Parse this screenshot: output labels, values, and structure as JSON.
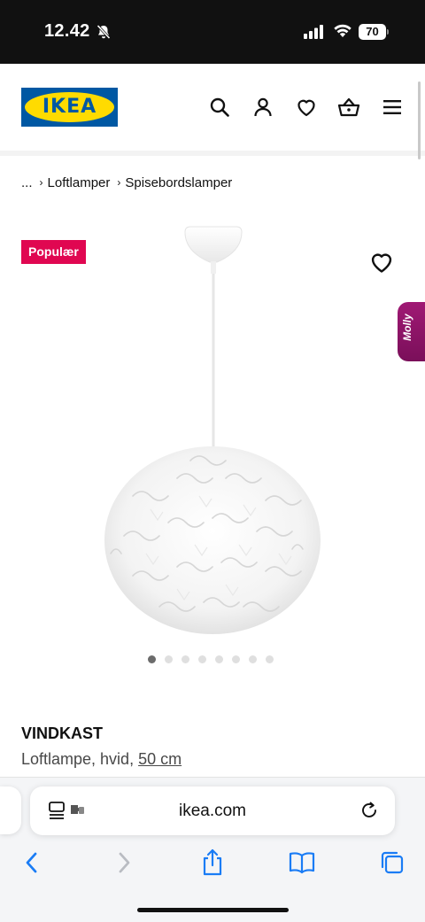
{
  "status_bar": {
    "time": "12.42",
    "battery": "70"
  },
  "header": {
    "logo_text": "IKEA"
  },
  "breadcrumb": {
    "ellipsis": "...",
    "items": [
      "Loftlamper",
      "Spisebordslamper"
    ]
  },
  "product": {
    "badge": "Populær",
    "name": "VINDKAST",
    "description": "Loftlampe, hvid, ",
    "size_link": "50 cm",
    "image_count": 8,
    "active_image": 1
  },
  "assistant": {
    "label": "Molly"
  },
  "browser": {
    "url": "ikea.com"
  },
  "colors": {
    "brand_blue": "#0058a3",
    "brand_yellow": "#ffdb00",
    "badge_red": "#e00751",
    "molly_purple": "#a01974",
    "safari_blue": "#1a7cf5"
  }
}
